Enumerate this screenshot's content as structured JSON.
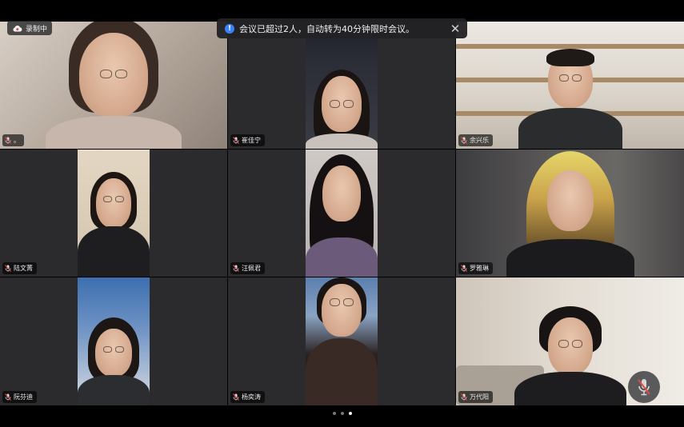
{
  "notice": {
    "text": "会议已超过2人，自动转为40分钟限时会议。",
    "close_symbol": "✕"
  },
  "recording": {
    "label": "录制中"
  },
  "participants": [
    {
      "name": "。",
      "layout": "full"
    },
    {
      "name": "崔佳宁",
      "layout": "narrow"
    },
    {
      "name": "余兴乐",
      "layout": "full"
    },
    {
      "name": "陆文菁",
      "layout": "narrow"
    },
    {
      "name": "汪佩君",
      "layout": "narrow"
    },
    {
      "name": "罗雅琳",
      "layout": "full"
    },
    {
      "name": "阮芬迪",
      "layout": "narrow"
    },
    {
      "name": "杨奕涛",
      "layout": "narrow"
    },
    {
      "name": "万代阳",
      "layout": "full"
    }
  ],
  "pager": {
    "pages": 3,
    "current": 2
  },
  "icons": {
    "recording": "cloud-record-icon",
    "info": "info-icon",
    "mic": "mic-muted-icon",
    "mute_button": "mic-mute-toggle-icon"
  },
  "colors": {
    "accent": "#3b82f6",
    "tile_bg": "#2b2b2d",
    "muted_red": "#e5484d"
  }
}
